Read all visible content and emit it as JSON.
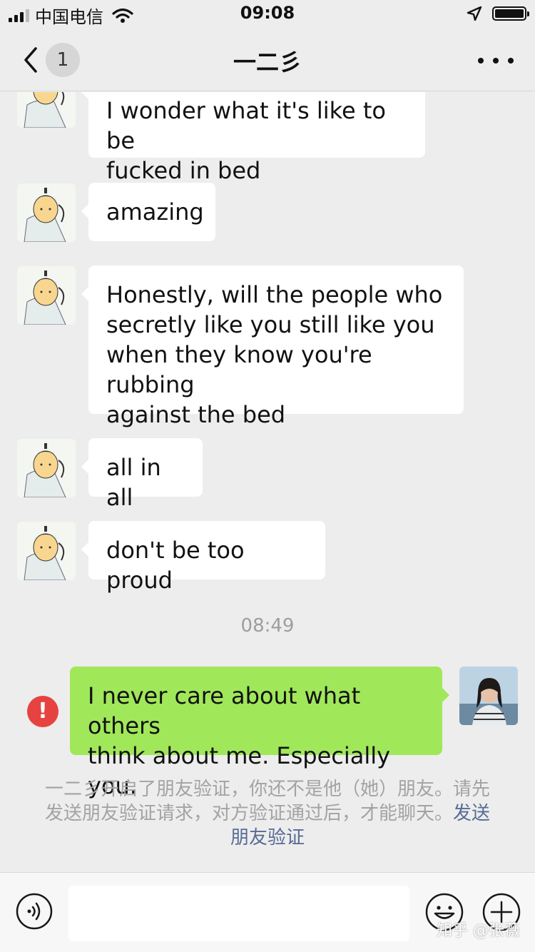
{
  "status_bar": {
    "carrier": "中国电信",
    "time": "09:08"
  },
  "navbar": {
    "unread_count": "1",
    "title": "一二彡"
  },
  "messages": [
    {
      "from": "contact",
      "text": "I wonder what it's like to be\nfucked in bed"
    },
    {
      "from": "contact",
      "text": "amazing"
    },
    {
      "from": "contact",
      "text": " Honestly, will the people who\nsecretly like you still like you\nwhen they know you're rubbing\n against the bed"
    },
    {
      "from": "contact",
      "text": "all in all"
    },
    {
      "from": "contact",
      "text": "don't be too proud"
    },
    {
      "from": "me",
      "text": "I never care about what others\nthink about me. Especially you.",
      "status": "failed"
    }
  ],
  "timestamp": "08:49",
  "system_message": {
    "text": "一二彡开启了朋友验证，你还不是他（她）朋友。请先发送朋友验证请求，对方验证通过后，才能聊天。",
    "link": "发送朋友验证"
  },
  "error_icon_text": "!",
  "watermark": "知乎 @张薇",
  "colors": {
    "outgoing_bubble": "#a0e75a",
    "incoming_bubble": "#ffffff",
    "background": "#ededed",
    "error": "#e64340",
    "link": "#576b95"
  },
  "icons": [
    "signal-icon",
    "wifi-icon",
    "location-icon",
    "battery-icon",
    "back-chevron-icon",
    "more-dots-icon",
    "voice-icon",
    "emoji-icon",
    "plus-icon"
  ]
}
